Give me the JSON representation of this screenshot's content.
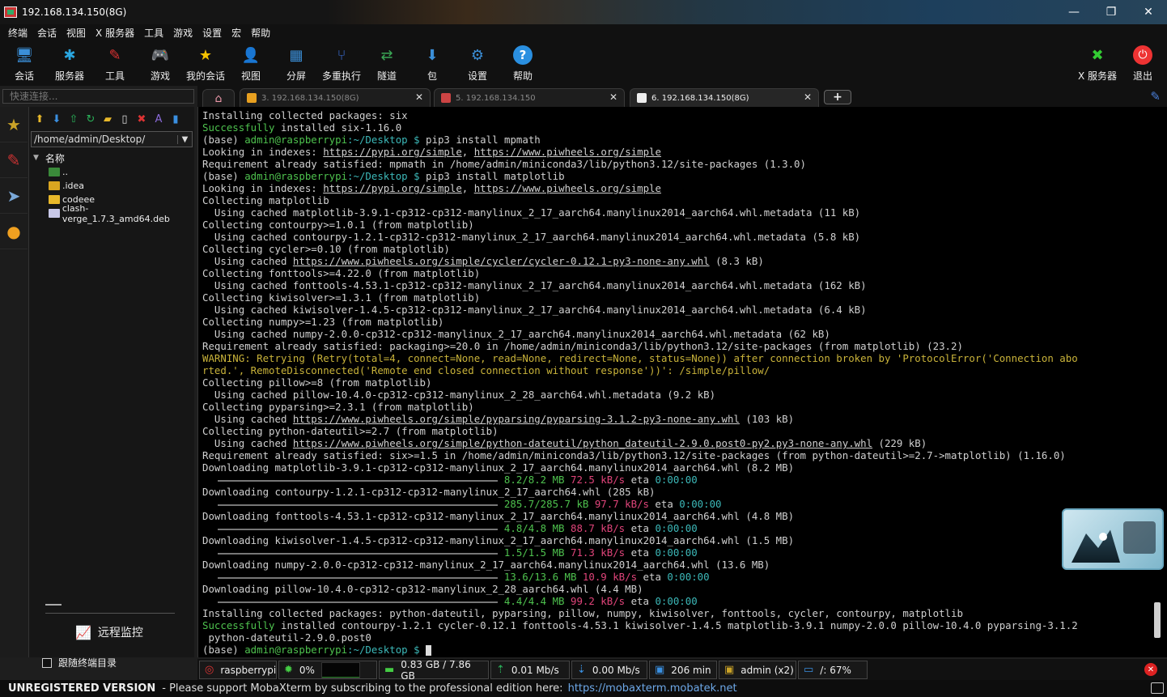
{
  "window": {
    "title": "192.168.134.150(8G)",
    "minimize": "—",
    "maximize": "❐",
    "close": "✕"
  },
  "menu": [
    "终端",
    "会话",
    "视图",
    "X 服务器",
    "工具",
    "游戏",
    "设置",
    "宏",
    "帮助"
  ],
  "toolbar": [
    {
      "label": "会话",
      "icon": "monitor-icon",
      "glyph": "🖥",
      "color": "#3b8fd8"
    },
    {
      "label": "服务器",
      "icon": "servers-icon",
      "glyph": "✱",
      "color": "#2aa6e0"
    },
    {
      "label": "工具",
      "icon": "tools-icon",
      "glyph": "✎",
      "color": "#d33"
    },
    {
      "label": "游戏",
      "icon": "gamepad-icon",
      "glyph": "🎮",
      "color": "#eee"
    },
    {
      "label": "我的会话",
      "icon": "star-icon",
      "glyph": "★",
      "color": "#f5c200"
    },
    {
      "label": "视图",
      "icon": "view-icon",
      "glyph": "👤",
      "color": "#3b8fd8"
    },
    {
      "label": "分屏",
      "icon": "split-icon",
      "glyph": "▦",
      "color": "#3b8fd8"
    },
    {
      "label": "多重执行",
      "icon": "multiexec-icon",
      "glyph": "⑂",
      "color": "#3b6fd8"
    },
    {
      "label": "隧道",
      "icon": "tunnel-icon",
      "glyph": "⇄",
      "color": "#3aa655"
    },
    {
      "label": "包",
      "icon": "package-icon",
      "glyph": "⬇",
      "color": "#3b8fd8"
    },
    {
      "label": "设置",
      "icon": "settings-icon",
      "glyph": "⚙",
      "color": "#3b8fd8"
    },
    {
      "label": "帮助",
      "icon": "help-icon",
      "glyph": "?",
      "color": "#2a8fe0"
    }
  ],
  "toolbar_right": [
    {
      "label": "X 服务器",
      "icon": "xserver-icon",
      "glyph": "✖",
      "color": "#3c3"
    },
    {
      "label": "退出",
      "icon": "power-icon",
      "glyph": "⏻",
      "color": "#e33"
    }
  ],
  "quick_connect": {
    "placeholder": "快速连接..."
  },
  "tabs": [
    {
      "label": "3. 192.168.134.150(8G)",
      "color": "#e8a020",
      "active": false
    },
    {
      "label": "5. 192.168.134.150",
      "color": "#c44",
      "active": false
    },
    {
      "label": "6. 192.168.134.150(8G)",
      "color": "#eee",
      "active": true
    }
  ],
  "sftp": {
    "path": "/home/admin/Desktop/",
    "column": "名称",
    "files": [
      {
        "name": "..",
        "color": "#3a8a3a"
      },
      {
        "name": ".idea",
        "color": "#d9a520"
      },
      {
        "name": "codeee",
        "color": "#e8b82a"
      },
      {
        "name": "clash-verge_1.7.3_amd64.deb",
        "color": "#c8c8e8"
      }
    ],
    "monitor": "远程监控",
    "follow": "跟随终端目录"
  },
  "terminal": {
    "prompt_user": "admin@raspberrypi",
    "prompt_path": ":~/Desktop $ ",
    "lines": [
      {
        "t": "plain",
        "text": "Installing collected packages: six"
      },
      {
        "t": "success",
        "a": "Successfully",
        "b": " installed six-1.16.0"
      },
      {
        "t": "prompt",
        "cmd": "pip3 install mpmath"
      },
      {
        "t": "index"
      },
      {
        "t": "plain",
        "text": "Requirement already satisfied: mpmath in /home/admin/miniconda3/lib/python3.12/site-packages (1.3.0)"
      },
      {
        "t": "prompt",
        "cmd": "pip3 install matplotlib"
      },
      {
        "t": "index"
      },
      {
        "t": "plain",
        "text": "Collecting matplotlib"
      },
      {
        "t": "plain",
        "text": "  Using cached matplotlib-3.9.1-cp312-cp312-manylinux_2_17_aarch64.manylinux2014_aarch64.whl.metadata (11 kB)"
      },
      {
        "t": "plain",
        "text": "Collecting contourpy>=1.0.1 (from matplotlib)"
      },
      {
        "t": "plain",
        "text": "  Using cached contourpy-1.2.1-cp312-cp312-manylinux_2_17_aarch64.manylinux2014_aarch64.whl.metadata (5.8 kB)"
      },
      {
        "t": "plain",
        "text": "Collecting cycler>=0.10 (from matplotlib)"
      },
      {
        "t": "link",
        "pre": "  Using cached ",
        "url": "https://www.piwheels.org/simple/cycler/cycler-0.12.1-py3-none-any.whl",
        "post": " (8.3 kB)"
      },
      {
        "t": "plain",
        "text": "Collecting fonttools>=4.22.0 (from matplotlib)"
      },
      {
        "t": "plain",
        "text": "  Using cached fonttools-4.53.1-cp312-cp312-manylinux_2_17_aarch64.manylinux2014_aarch64.whl.metadata (162 kB)"
      },
      {
        "t": "plain",
        "text": "Collecting kiwisolver>=1.3.1 (from matplotlib)"
      },
      {
        "t": "plain",
        "text": "  Using cached kiwisolver-1.4.5-cp312-cp312-manylinux_2_17_aarch64.manylinux2014_aarch64.whl.metadata (6.4 kB)"
      },
      {
        "t": "plain",
        "text": "Collecting numpy>=1.23 (from matplotlib)"
      },
      {
        "t": "plain",
        "text": "  Using cached numpy-2.0.0-cp312-cp312-manylinux_2_17_aarch64.manylinux2014_aarch64.whl.metadata (62 kB)"
      },
      {
        "t": "plain",
        "text": "Requirement already satisfied: packaging>=20.0 in /home/admin/miniconda3/lib/python3.12/site-packages (from matplotlib) (23.2)"
      },
      {
        "t": "warn",
        "text": "WARNING: Retrying (Retry(total=4, connect=None, read=None, redirect=None, status=None)) after connection broken by 'ProtocolError('Connection abo"
      },
      {
        "t": "warn",
        "text": "rted.', RemoteDisconnected('Remote end closed connection without response'))': /simple/pillow/"
      },
      {
        "t": "plain",
        "text": "Collecting pillow>=8 (from matplotlib)"
      },
      {
        "t": "plain",
        "text": "  Using cached pillow-10.4.0-cp312-cp312-manylinux_2_28_aarch64.whl.metadata (9.2 kB)"
      },
      {
        "t": "plain",
        "text": "Collecting pyparsing>=2.3.1 (from matplotlib)"
      },
      {
        "t": "link",
        "pre": "  Using cached ",
        "url": "https://www.piwheels.org/simple/pyparsing/pyparsing-3.1.2-py3-none-any.whl",
        "post": " (103 kB)"
      },
      {
        "t": "plain",
        "text": "Collecting python-dateutil>=2.7 (from matplotlib)"
      },
      {
        "t": "link",
        "pre": "  Using cached ",
        "url": "https://www.piwheels.org/simple/python-dateutil/python_dateutil-2.9.0.post0-py2.py3-none-any.whl",
        "post": " (229 kB)"
      },
      {
        "t": "plain",
        "text": "Requirement already satisfied: six>=1.5 in /home/admin/miniconda3/lib/python3.12/site-packages (from python-dateutil>=2.7->matplotlib) (1.16.0)"
      },
      {
        "t": "plain",
        "text": "Downloading matplotlib-3.9.1-cp312-cp312-manylinux_2_17_aarch64.manylinux2014_aarch64.whl (8.2 MB)"
      },
      {
        "t": "progress",
        "size": "8.2/8.2 MB",
        "speed": "72.5 kB/s",
        "eta": "0:00:00"
      },
      {
        "t": "plain",
        "text": "Downloading contourpy-1.2.1-cp312-cp312-manylinux_2_17_aarch64.whl (285 kB)"
      },
      {
        "t": "progress",
        "size": "285.7/285.7 kB",
        "speed": "97.7 kB/s",
        "eta": "0:00:00"
      },
      {
        "t": "plain",
        "text": "Downloading fonttools-4.53.1-cp312-cp312-manylinux_2_17_aarch64.manylinux2014_aarch64.whl (4.8 MB)"
      },
      {
        "t": "progress",
        "size": "4.8/4.8 MB",
        "speed": "88.7 kB/s",
        "eta": "0:00:00"
      },
      {
        "t": "plain",
        "text": "Downloading kiwisolver-1.4.5-cp312-cp312-manylinux_2_17_aarch64.manylinux2014_aarch64.whl (1.5 MB)"
      },
      {
        "t": "progress",
        "size": "1.5/1.5 MB",
        "speed": "71.3 kB/s",
        "eta": "0:00:00"
      },
      {
        "t": "plain",
        "text": "Downloading numpy-2.0.0-cp312-cp312-manylinux_2_17_aarch64.manylinux2014_aarch64.whl (13.6 MB)"
      },
      {
        "t": "progress",
        "size": "13.6/13.6 MB",
        "speed": "10.9 kB/s",
        "eta": "0:00:00"
      },
      {
        "t": "plain",
        "text": "Downloading pillow-10.4.0-cp312-cp312-manylinux_2_28_aarch64.whl (4.4 MB)"
      },
      {
        "t": "progress",
        "size": "4.4/4.4 MB",
        "speed": "99.2 kB/s",
        "eta": "0:00:00"
      },
      {
        "t": "plain",
        "text": "Installing collected packages: python-dateutil, pyparsing, pillow, numpy, kiwisolver, fonttools, cycler, contourpy, matplotlib"
      },
      {
        "t": "success",
        "a": "Successfully",
        "b": " installed contourpy-1.2.1 cycler-0.12.1 fonttools-4.53.1 kiwisolver-1.4.5 matplotlib-3.9.1 numpy-2.0.0 pillow-10.4.0 pyparsing-3.1.2"
      },
      {
        "t": "plain",
        "text": " python-dateutil-2.9.0.post0"
      },
      {
        "t": "prompt",
        "cmd": ""
      }
    ],
    "index_pre": "Looking in indexes: ",
    "index_url1": "https://pypi.org/simple",
    "index_url2": "https://www.piwheels.org/simple"
  },
  "status": {
    "host": "raspberrypi",
    "cpu": "0%",
    "cpu_level": 0.02,
    "memory": "0.83 GB / 7.86 GB",
    "upload": "0.01 Mb/s",
    "download": "0.00 Mb/s",
    "uptime": "206 min",
    "user": "admin (x2)",
    "disk": "/: 67%"
  },
  "banner": {
    "unregistered": "UNREGISTERED VERSION",
    "message": " -  Please support MobaXterm by subscribing to the professional edition here:",
    "link": "https://mobaxterm.mobatek.net"
  }
}
